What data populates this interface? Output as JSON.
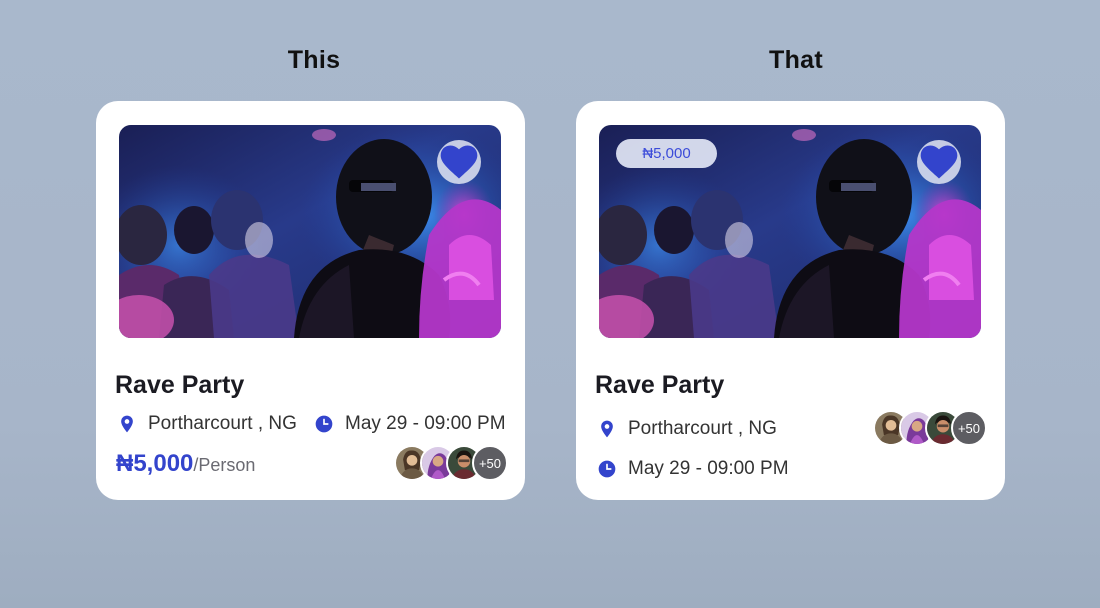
{
  "headings": {
    "left": "This",
    "right": "That"
  },
  "card_this": {
    "title": "Rave Party",
    "location": "Portharcourt , NG",
    "datetime": "May 29 - 09:00 PM",
    "price": "₦5,000",
    "price_unit": "/Person",
    "attendees_more": "+50"
  },
  "card_that": {
    "price_badge": "₦5,000",
    "title": "Rave Party",
    "location": "Portharcourt , NG",
    "datetime": "May 29 - 09:00 PM",
    "attendees_more": "+50"
  },
  "icons": {
    "favorite": "heart-icon",
    "location": "map-pin-icon",
    "time": "clock-icon"
  },
  "colors": {
    "accent": "#3344cc",
    "badge_text": "#3b4bd9",
    "background": "#a9b8cc",
    "card": "#ffffff"
  }
}
